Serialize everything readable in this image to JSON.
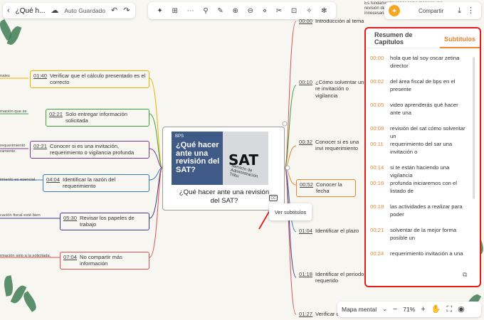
{
  "topbar": {
    "title": "¿Qué h...",
    "autosave": "Auto Guardado",
    "back_icon": "chevron-left-icon"
  },
  "toolbar": {
    "tools": [
      "✦",
      "⊞",
      "⋯",
      "⚲",
      "✎",
      "⊕",
      "⊖",
      "⋄",
      "✂",
      "⊡",
      "✧",
      "✻"
    ]
  },
  "share": {
    "label": "Compartir"
  },
  "snippets": {
    "top_right": "Es fundamental saber como manejar una revisión del SAT para evitar sanciones innecesarias.",
    "edge_texts": [
      "nales",
      "mación que se",
      "requerimiento",
      "ramente.",
      "imiento es esencial.",
      "cación fiscal esté bien",
      "rmación solo a la solicitada."
    ]
  },
  "left_nodes": [
    {
      "time": "01:40",
      "text": "Verificar que el cálculo presentado es el correcto"
    },
    {
      "time": "02:21",
      "text": "Solo entregar información solicitada"
    },
    {
      "time": "02:21",
      "text": "Conocer si es una invitación, requerimiento o vigilancia profunda"
    },
    {
      "time": "04:04",
      "text": "Identificar la razón del requerimiento"
    },
    {
      "time": "05:30",
      "text": "Revisar los papeles de trabajo"
    },
    {
      "time": "07:04",
      "text": "No compartir más información"
    }
  ],
  "right_nodes": [
    {
      "time": "00:00",
      "text": "Introducción al tema"
    },
    {
      "time": "00:10",
      "text": "¿Cómo solventar un re invitación o vigilancia"
    },
    {
      "time": "00:32",
      "text": "Conocer si es una invi requerimiento"
    },
    {
      "time": "00:52",
      "text": "Conocer la fecha"
    },
    {
      "time": "01:04",
      "text": "Identificar el plazo"
    },
    {
      "time": "01:18",
      "text": "Identificar el periodo requerido"
    },
    {
      "time": "01:27",
      "text": "Verificar el"
    }
  ],
  "center": {
    "thumb_brand": "BPS",
    "thumb_headline": "¿Qué hacer ante una revisión del SAT?",
    "thumb_sat": "SAT",
    "thumb_sat_sub": "Servicio de Administración Tribu",
    "caption": "¿Qué hacer ante una revisión del SAT?",
    "cc_label": "CC",
    "tooltip": "Ver subtitulos"
  },
  "panel": {
    "tab_summary": "Resumen de Capítulos",
    "tab_subtitles": "Subtítulos",
    "subtitles": [
      {
        "time": "00:00",
        "text": "hola que tal soy oscar zetina director"
      },
      {
        "time": "00:02",
        "text": "del área fiscal de bps en el presente"
      },
      {
        "time": "00:05",
        "text": "video aprenderás qué hacer ante una"
      },
      {
        "time": "00:08",
        "text": "revisión del sat cómo solventar un"
      },
      {
        "time": "00:11",
        "text": "requerimiento del sar una invitación o"
      },
      {
        "time": "00:14",
        "text": "si te están haciendo una vigilancia"
      },
      {
        "time": "00:16",
        "text": "profunda iniciaremos con el listado de"
      },
      {
        "time": "00:18",
        "text": "las actividades a realizar para poder"
      },
      {
        "time": "00:21",
        "text": "solventar de la mejor forma posible un"
      },
      {
        "time": "00:24",
        "text": "requerimiento invitación a una"
      }
    ]
  },
  "bottom": {
    "view_mode": "Mapa mental",
    "zoom": "71%"
  },
  "colors": {
    "accent": "#e8852f",
    "panel_border": "#e21b1b",
    "branch_yellow": "#f0b000",
    "branch_green": "#3aa43a",
    "branch_purple": "#7a3b8c",
    "branch_blue": "#3a7abf",
    "branch_red": "#e05050",
    "branch_orange": "#e8852f"
  }
}
